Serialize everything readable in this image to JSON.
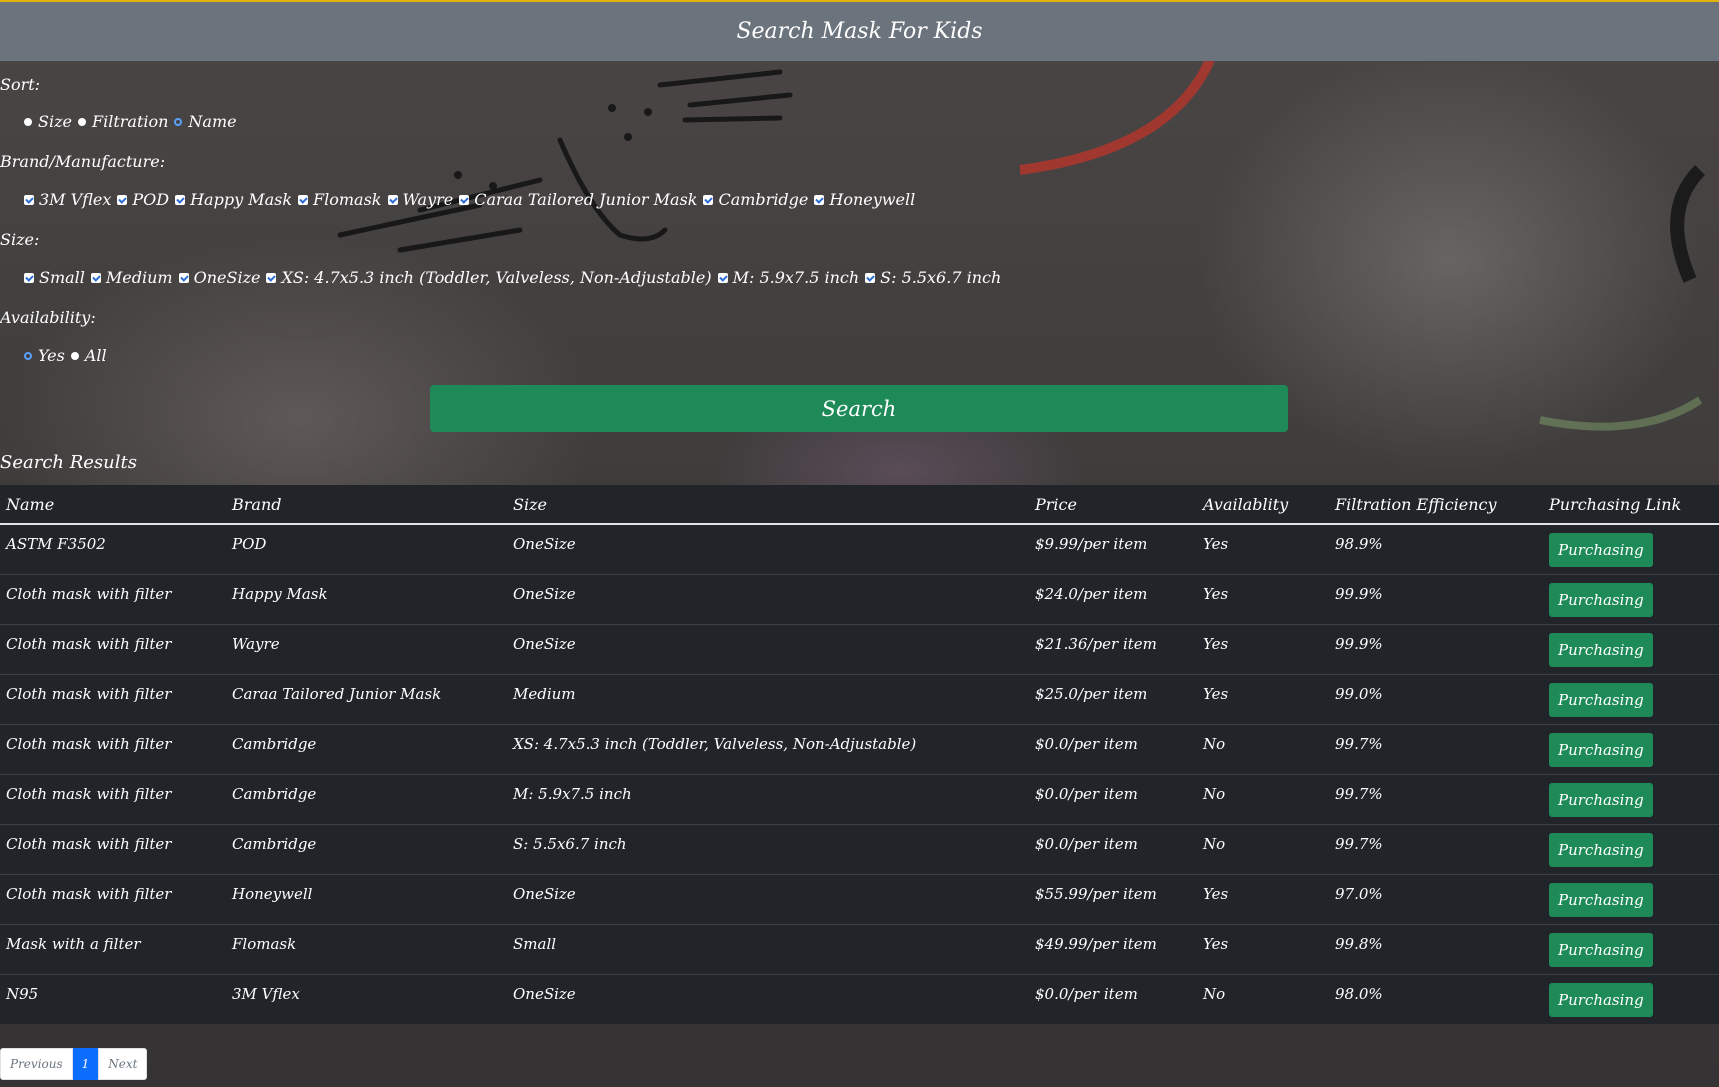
{
  "header": {
    "title": "Search Mask For Kids"
  },
  "filters": {
    "sort": {
      "label": "Sort:",
      "options": [
        {
          "label": "Size",
          "selected": true
        },
        {
          "label": "Filtration",
          "selected": true
        },
        {
          "label": "Name",
          "selected": false
        }
      ]
    },
    "brand": {
      "label": "Brand/Manufacture:",
      "options": [
        "3M Vflex",
        "POD",
        "Happy Mask",
        "Flomask",
        "Wayre",
        "Caraa Tailored Junior Mask",
        "Cambridge",
        "Honeywell"
      ]
    },
    "size": {
      "label": "Size:",
      "options": [
        "Small",
        "Medium",
        "OneSize",
        "XS: 4.7x5.3 inch (Toddler, Valveless, Non-Adjustable)",
        "M: 5.9x7.5 inch",
        "S: 5.5x6.7 inch"
      ]
    },
    "availability": {
      "label": "Availability:",
      "options": [
        {
          "label": "Yes",
          "selected": false
        },
        {
          "label": "All",
          "selected": true
        }
      ]
    }
  },
  "search_button": "Search",
  "results": {
    "title": "Search Results",
    "columns": [
      "Name",
      "Brand",
      "Size",
      "Price",
      "Availablity",
      "Filtration Efficiency",
      "Purchasing Link"
    ],
    "rows": [
      [
        "ASTM F3502",
        "POD",
        "OneSize",
        "$9.99/per item",
        "Yes",
        "98.9%",
        "Purchasing"
      ],
      [
        "Cloth mask with filter",
        "Happy Mask",
        "OneSize",
        "$24.0/per item",
        "Yes",
        "99.9%",
        "Purchasing"
      ],
      [
        "Cloth mask with filter",
        "Wayre",
        "OneSize",
        "$21.36/per item",
        "Yes",
        "99.9%",
        "Purchasing"
      ],
      [
        "Cloth mask with filter",
        "Caraa Tailored Junior Mask",
        "Medium",
        "$25.0/per item",
        "Yes",
        "99.0%",
        "Purchasing"
      ],
      [
        "Cloth mask with filter",
        "Cambridge",
        "XS: 4.7x5.3 inch (Toddler, Valveless, Non-Adjustable)",
        "$0.0/per item",
        "No",
        "99.7%",
        "Purchasing"
      ],
      [
        "Cloth mask with filter",
        "Cambridge",
        "M: 5.9x7.5 inch",
        "$0.0/per item",
        "No",
        "99.7%",
        "Purchasing"
      ],
      [
        "Cloth mask with filter",
        "Cambridge",
        "S: 5.5x6.7 inch",
        "$0.0/per item",
        "No",
        "99.7%",
        "Purchasing"
      ],
      [
        "Cloth mask with filter",
        "Honeywell",
        "OneSize",
        "$55.99/per item",
        "Yes",
        "97.0%",
        "Purchasing"
      ],
      [
        "Mask with a filter",
        "Flomask",
        "Small",
        "$49.99/per item",
        "Yes",
        "99.8%",
        "Purchasing"
      ],
      [
        "N95",
        "3M Vflex",
        "OneSize",
        "$0.0/per item",
        "No",
        "98.0%",
        "Purchasing"
      ]
    ]
  },
  "pagination": {
    "previous": "Previous",
    "current": "1",
    "next": "Next"
  },
  "colors": {
    "header_bg": "#6b737c",
    "accent_border": "#e0b20a",
    "button_green": "#1e8a57",
    "table_bg": "#212529",
    "active_page": "#0d6efd"
  }
}
